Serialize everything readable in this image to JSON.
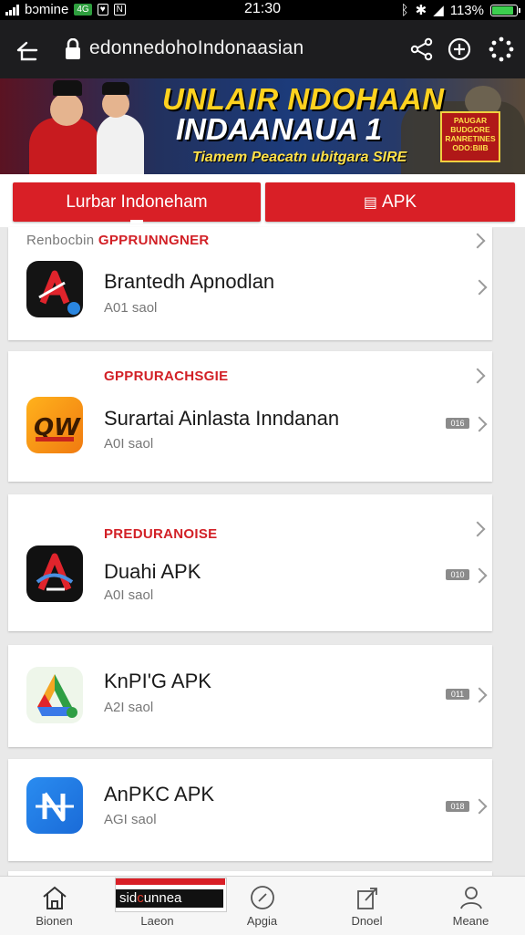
{
  "status_bar": {
    "carrier": "bɔmine",
    "box1": "4G",
    "box2": "♥",
    "box3": "N",
    "time": "21:30",
    "battery_text": "113%",
    "battery_level": 0.9
  },
  "browser": {
    "url": "edonnedohoIndonaasian"
  },
  "banner": {
    "line1": "UNLAIR NDOHAAN",
    "line2": "INDAANAUA 1",
    "line3": "Tiamem Peacatn ubitgara SIRE",
    "badge": "PAUGAR BUDGORE RANRETINES ODO:BIIB"
  },
  "tabs": {
    "left_label": "Lurbar Indoneham",
    "right_label": "APK"
  },
  "cards": [
    {
      "section_gray": "Renbocbin",
      "section_red": "GPPRUNNGNER",
      "title": "Brantedh Apnodlan",
      "sub": "A01 saol",
      "tag": ""
    },
    {
      "section_gray": "",
      "section_red": "GPPRURACHSGIE",
      "title": "Surartai Ainlasta Inndanan",
      "sub": "A0I saol",
      "tag": "016"
    },
    {
      "section_gray": "",
      "section_red": "PREDURANOISE",
      "title": "Duahi APK",
      "sub": "A0I saol",
      "tag": "010"
    },
    {
      "section_gray": "",
      "section_red": "",
      "title": "KnPI'G APK",
      "sub": "A2I saol",
      "tag": "011"
    },
    {
      "section_gray": "",
      "section_red": "",
      "title": "AnPKC APK",
      "sub": "AGI saol",
      "tag": "018"
    }
  ],
  "overlay": {
    "text_pre": "sid",
    "text_red": "c",
    "text_post": "unnea"
  },
  "bottom_nav": [
    {
      "label": "Bionen",
      "icon": "home-icon"
    },
    {
      "label": "Laeon",
      "icon": "overlay-icon"
    },
    {
      "label": "Apgia",
      "icon": "compass-icon"
    },
    {
      "label": "Dnoel",
      "icon": "share-box-icon"
    },
    {
      "label": "Meane",
      "icon": "profile-icon"
    }
  ],
  "colors": {
    "accent": "#d91f26",
    "status_bg": "#000000",
    "url_bar_bg": "#1d1d1f"
  }
}
